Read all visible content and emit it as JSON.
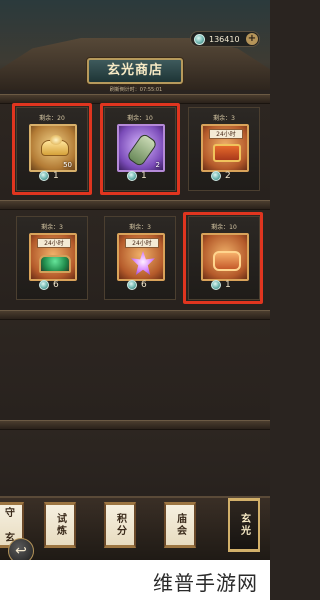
{
  "header": {
    "currency_value": "136410",
    "shop_title": "玄光商店",
    "refresh_text": "刷新倒计时：07:55:01"
  },
  "items": [
    {
      "remain": "剩余：20",
      "qty": "50",
      "price": "1",
      "timer": "",
      "art": "gold-ingot-icon",
      "highlight": true
    },
    {
      "remain": "剩余：10",
      "qty": "2",
      "price": "1",
      "timer": "",
      "art": "scroll-icon",
      "highlight": true
    },
    {
      "remain": "剩余：3",
      "qty": "",
      "price": "2",
      "timer": "24小时",
      "art": "red-gift-box-icon",
      "highlight": false
    },
    {
      "remain": "剩余：3",
      "qty": "",
      "price": "6",
      "timer": "24小时",
      "art": "treasure-cart-icon",
      "highlight": false
    },
    {
      "remain": "剩余：3",
      "qty": "",
      "price": "6",
      "timer": "24小时",
      "art": "lotus-icon",
      "highlight": false
    },
    {
      "remain": "剩余：10",
      "qty": "",
      "price": "1",
      "timer": "",
      "art": "red-chest-icon",
      "highlight": true
    }
  ],
  "nav": {
    "tabs": [
      {
        "label": "守\n玄",
        "active": false
      },
      {
        "label": "试炼",
        "active": false
      },
      {
        "label": "积分",
        "active": false
      },
      {
        "label": "庙会",
        "active": false
      },
      {
        "label": "玄光",
        "active": true
      }
    ]
  },
  "watermark": "维普手游网",
  "colors": {
    "highlight_red": "#e0351f",
    "gold_border": "#b79a5c"
  }
}
